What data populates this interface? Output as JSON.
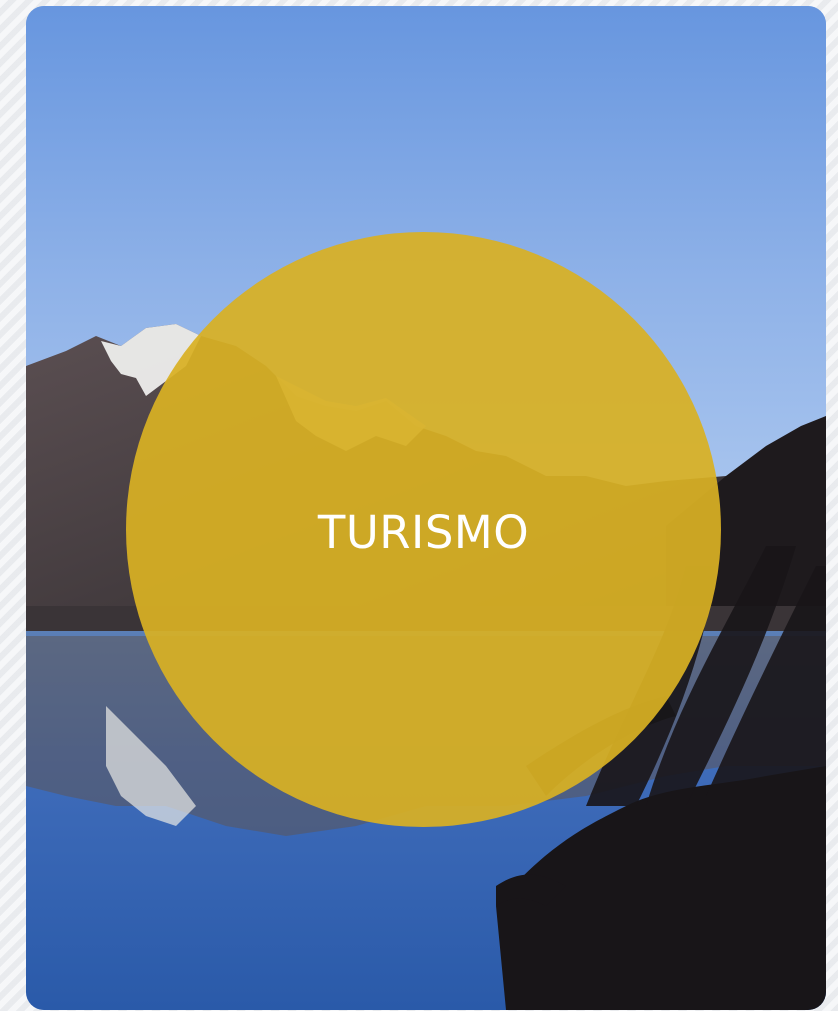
{
  "tile": {
    "title": "TURISMO",
    "image": {
      "subject": "landscape-photo",
      "colors": {
        "sky_top": "#6f9ee2",
        "sky_bottom": "#a7c6f0",
        "water": "#2e5fb5",
        "mountain_dark": "#3b3538",
        "snow": "#f2f1ee",
        "plant": "#1c1a1c"
      }
    },
    "overlay": {
      "shape": "circle",
      "color": "#d8b023"
    }
  }
}
